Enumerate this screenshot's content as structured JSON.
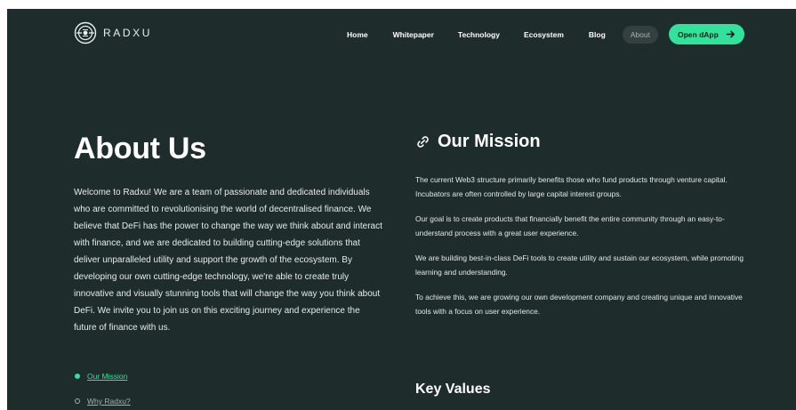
{
  "brand": {
    "name": "RADXU",
    "logo_icon": "radxu-logo-icon"
  },
  "colors": {
    "background": "#1e2c2b",
    "accent": "#31e29a",
    "text": "#ffffff",
    "muted": "#a8b1af"
  },
  "nav": {
    "items": [
      {
        "label": "Home"
      },
      {
        "label": "Whitepaper"
      },
      {
        "label": "Technology"
      },
      {
        "label": "Ecosystem"
      },
      {
        "label": "Blog"
      },
      {
        "label": "About"
      }
    ],
    "active": "About",
    "cta_label": "Open dApp",
    "cta_icon": "arrow-right-icon"
  },
  "about": {
    "title": "About Us",
    "body": "Welcome to Radxu! We are a team of passionate and dedicated individuals who are committed to revolutionising the world of decentralised finance. We believe that DeFi has the power to change the way we think about and interact with finance, and we are dedicated to building cutting-edge solutions that deliver unparalleled utility and support the growth of the ecosystem. By developing our own cutting-edge technology, we're able to create truly innovative and visually stunning tools that will change the way you think about DeFi. We invite you to join us on this exciting journey and experience the future of finance with us."
  },
  "toc": {
    "items": [
      {
        "label": "Our Mission",
        "active": true
      },
      {
        "label": "Why Radxu?",
        "active": false
      }
    ]
  },
  "mission": {
    "icon": "link-icon",
    "heading": "Our Mission",
    "paragraphs": [
      "The current Web3 structure primarily benefits those who fund products through venture capital. Incubators are often controlled by large capital interest groups.",
      "Our goal is to create products that financially benefit the entire community through an easy-to-understand process with a great user experience.",
      "We are building best-in-class DeFi tools to create utility and sustain our ecosystem, while promoting learning and understanding.",
      "To achieve this, we are growing our own development company and creating unique and innovative tools with a focus on user experience."
    ]
  },
  "key_values": {
    "heading": "Key Values"
  }
}
